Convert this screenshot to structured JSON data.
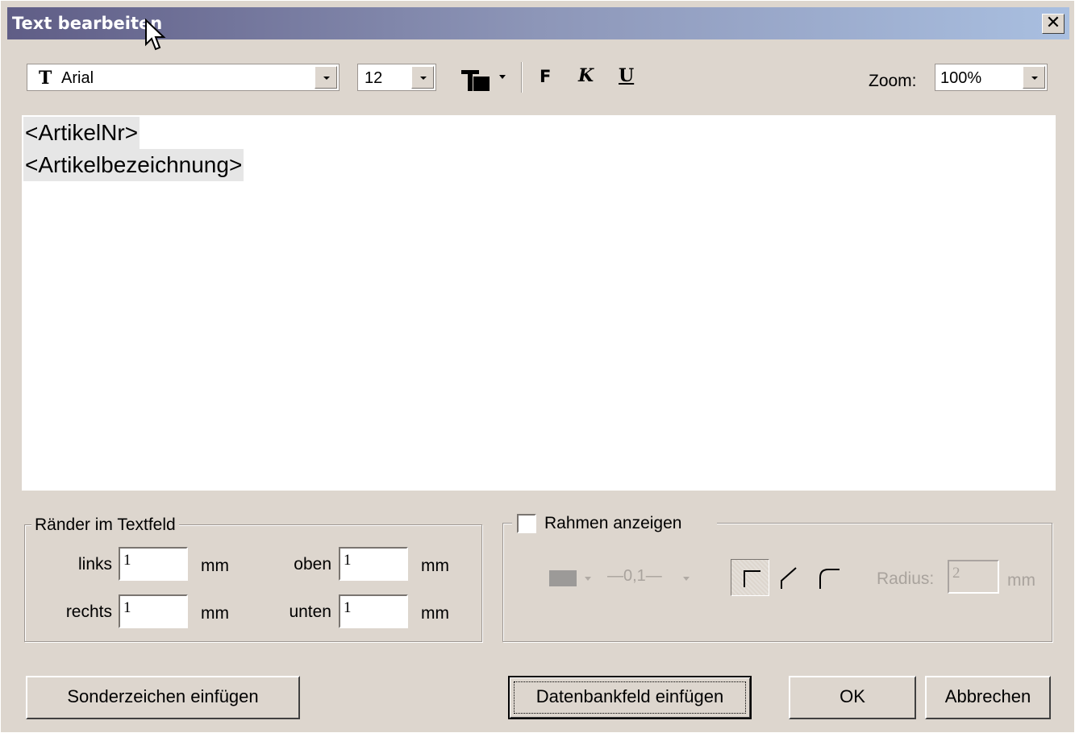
{
  "window": {
    "title": "Text bearbeiten",
    "close_label": "✕"
  },
  "toolbar": {
    "font": "Arial",
    "font_icon": "T",
    "size": "12",
    "bold_label": "F",
    "italic_label": "K",
    "underline_label": "U",
    "zoom_label": "Zoom:",
    "zoom_value": "100%"
  },
  "editor": {
    "lines": [
      "<ArtikelNr>",
      "<Artikelbezeichnung>"
    ]
  },
  "margins": {
    "legend": "Ränder im Textfeld",
    "links_label": "links",
    "links_value": "1",
    "rechts_label": "rechts",
    "rechts_value": "1",
    "oben_label": "oben",
    "oben_value": "1",
    "unten_label": "unten",
    "unten_value": "1",
    "unit": "mm"
  },
  "frame": {
    "checkbox_label": "Rahmen anzeigen",
    "checked": false,
    "line_width": "—0,1—",
    "radius_label": "Radius:",
    "radius_value": "2",
    "unit": "mm"
  },
  "buttons": {
    "special_chars": "Sonderzeichen einfügen",
    "db_field": "Datenbankfeld einfügen",
    "ok": "OK",
    "cancel": "Abbrechen"
  }
}
